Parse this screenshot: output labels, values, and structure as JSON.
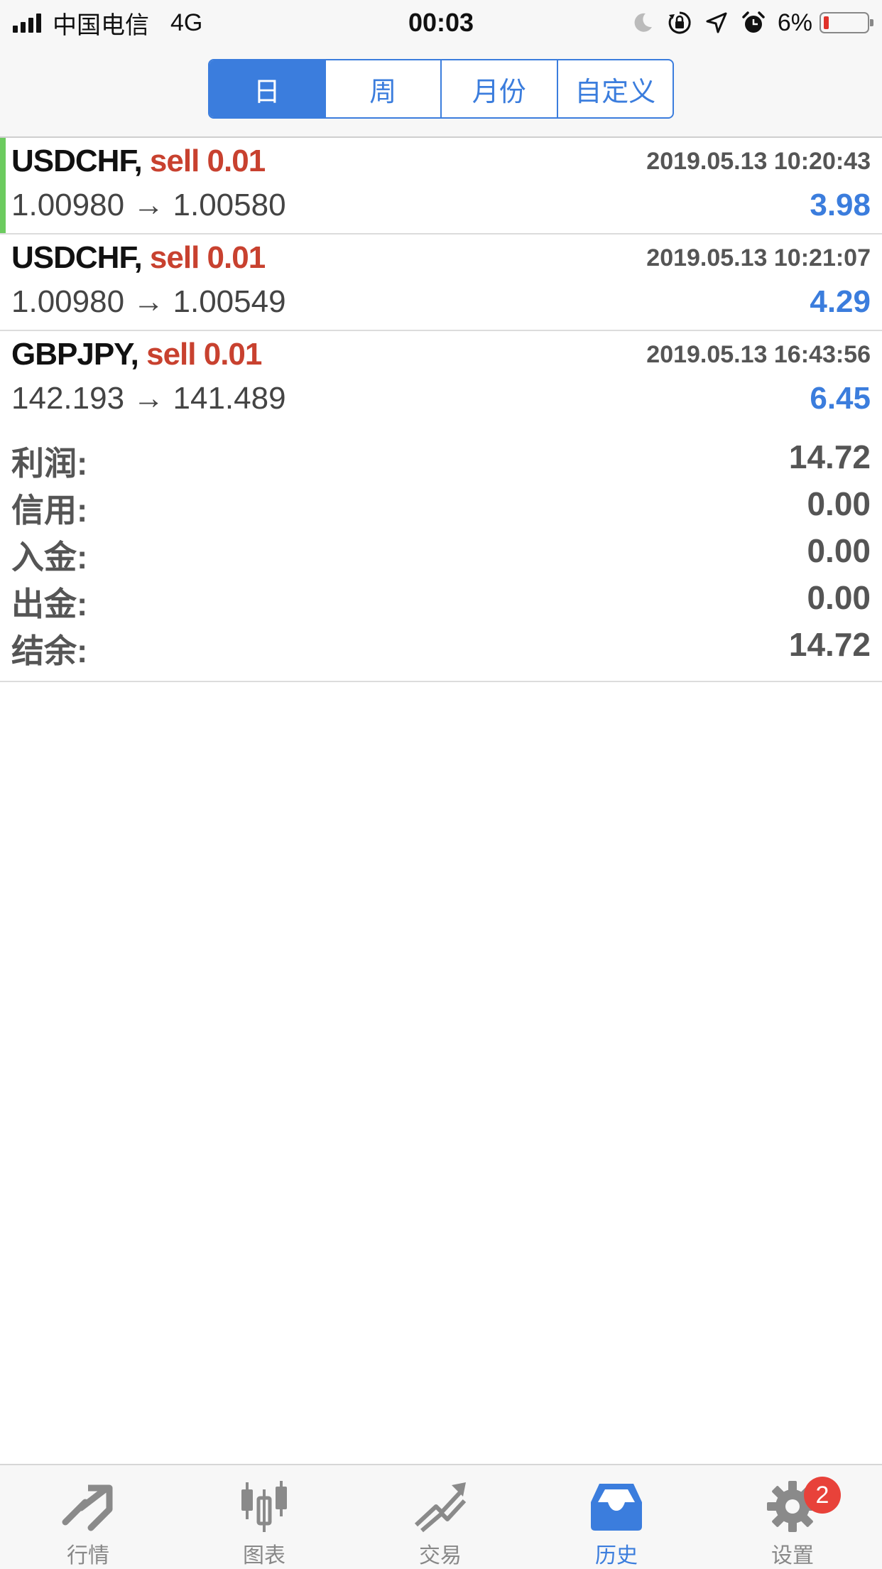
{
  "status_bar": {
    "carrier": "中国电信",
    "network": "4G",
    "time": "00:03",
    "battery": "6%"
  },
  "segments": [
    {
      "label": "日",
      "active": true
    },
    {
      "label": "周",
      "active": false
    },
    {
      "label": "月份",
      "active": false
    },
    {
      "label": "自定义",
      "active": false
    }
  ],
  "trades": [
    {
      "symbol": "USDCHF,",
      "action": "sell 0.01",
      "time": "2019.05.13 10:20:43",
      "prices": "1.00980 → 1.00580",
      "profit": "3.98"
    },
    {
      "symbol": "USDCHF,",
      "action": "sell 0.01",
      "time": "2019.05.13 10:21:07",
      "prices": "1.00980 → 1.00549",
      "profit": "4.29"
    },
    {
      "symbol": "GBPJPY,",
      "action": "sell 0.01",
      "time": "2019.05.13 16:43:56",
      "prices": "142.193 → 141.489",
      "profit": "6.45"
    }
  ],
  "summary": [
    {
      "label": "利润:",
      "value": "14.72"
    },
    {
      "label": "信用:",
      "value": "0.00"
    },
    {
      "label": "入金:",
      "value": "0.00"
    },
    {
      "label": "出金:",
      "value": "0.00"
    },
    {
      "label": "结余:",
      "value": "14.72"
    }
  ],
  "tabs": [
    {
      "label": "行情",
      "icon": "quotes-icon"
    },
    {
      "label": "图表",
      "icon": "chart-icon"
    },
    {
      "label": "交易",
      "icon": "trade-icon"
    },
    {
      "label": "历史",
      "icon": "history-icon",
      "active": true
    },
    {
      "label": "设置",
      "icon": "settings-icon",
      "badge": "2"
    }
  ],
  "colors": {
    "accent": "#3b7ddd",
    "sell": "#c8412f",
    "profit": "#3b7ddd",
    "badge": "#e8423a",
    "row_marker": "#6ccb5f"
  }
}
